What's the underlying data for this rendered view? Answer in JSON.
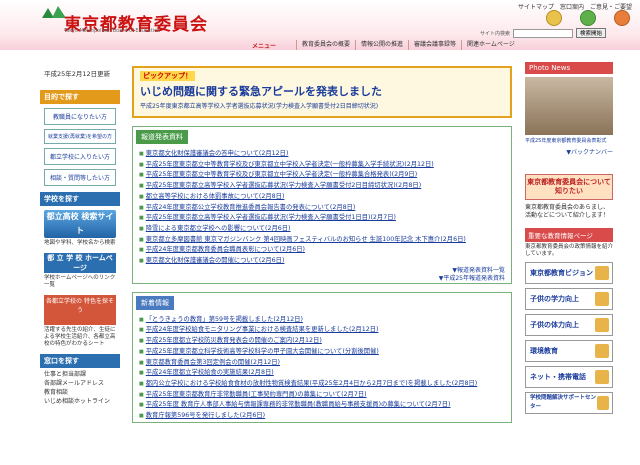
{
  "header": {
    "title": "東京都教育委員会",
    "subtitle": "Tokyo Metropolitan Board of Education",
    "top_links": [
      "サイトマップ",
      "窓口案内",
      "ご意見・ご要望"
    ],
    "search_label": "サイト内検索",
    "search_button": "検索開始"
  },
  "nav": {
    "menu_label": "メニュー",
    "items": [
      "教育委員会の概要",
      "情報公開の推進",
      "審議会議事録等",
      "関連ホームページ"
    ]
  },
  "date": "平成25年2月12日更新",
  "left": {
    "purpose_head": "目的で探す",
    "purpose_buttons": [
      "教職員になりたい方",
      "就業支援(再就業)を希望の方",
      "都立学校に入りたい方",
      "相談・質問等したい方"
    ],
    "school_head": "学校を探す",
    "banner1": "都立高校 検索サイト",
    "banner1_desc": "地図や学科、学校名から検索",
    "banner2": "都 立 学 校 ホームページ",
    "banner2_desc": "学校ホームページへのリンク一覧",
    "banner3": "各都立学校の 特色を探そう",
    "banner3_desc": "活躍する先生の紹介、生徒による学校生活紹介、各都立高校の特色がわかるシート",
    "mado_head": "窓口を探す",
    "mado_links": [
      "仕事と担当部課",
      "各部課メールアドレス",
      "教育相談",
      "いじめ相談ホットライン"
    ]
  },
  "pickup": {
    "label": "ピックアップ！",
    "main": "いじめ問題に関する緊急アピールを発表しました",
    "sub": "平成25年度東京都立高等学校入学者選抜応募状況(学力検査入学願書受付2日目締切状況)"
  },
  "press": {
    "head": "報道発表資料",
    "items": [
      "東京都文化財保護審議会の答申について(2月12日)",
      "平成25年度東京都立中等教育学校及び東京都立中学校入学者決定(一般枠募集入学手続状況)(2月12日)",
      "平成25年度東京都立中等教育学校及び東京都立中学校入学者決定(一般枠募集合格発表)(2月9日)",
      "平成25年度東京都立高等学校入学者選抜応募状況(学力検査入学願書受付2日目締切状況)(2月8日)",
      "都立高等学校における体罰事故について(2月8日)",
      "平成24年度東京都公立学校教育推進委員会報告書の発表について(2月8日)",
      "平成25年度東京都立高等学校入学者選抜応募状況(学力検査入学願書受付1日目)(2月7日)",
      "降雪による東京都立学校への影響について(2月6日)",
      "東京都立多摩図書館 東京マガジンバンク 第4回映画フェスティバルのお知らせ 生誕100年記念 木下惠介(2月6日)",
      "平成24年度東京都教育委員会職員表彰について(2月6日)",
      "東京都文化財保護審議会の開催について(2月6日)"
    ],
    "more1": "▼報道発表資料一覧",
    "more2": "▼平成25年報道発表資料"
  },
  "news": {
    "head": "新着情報",
    "items": [
      "「とうきょうの教育」第59号を掲載しました(2月12日)",
      "平成24年度学校給食モニタリング事業における検査結果を更新しました(2月12日)",
      "平成25年度都立学校防災教育発表会の開催のご案内(2月12日)",
      "平成25年度東京都立科学技術高等学校科学の甲子園大会開催について(分割後開催)",
      "東京都教育委員会第3回定例会の開催(2月12日)",
      "平成24年度都立学校給食の実施結果(2月8日)",
      "都内公立学校における学校給食食材の放射性物質検査結果(平成25年2月4日から2月7日まで)を掲載しました(2月8日)",
      "平成25年度東京都教育庁非常勤職員(工事契約専門員)の募集について(2月7日)",
      "平成25年度 教育庁人事部人事給与情報課専務的非常勤職員(教職員給与事務支援員)の募集について(2月7日)",
      "教育庁報第596号を発行しました(2月6日)"
    ]
  },
  "right": {
    "photo_head": "Photo News",
    "photo_caption": "平成25年度東京都教育委員会表彰式",
    "back_number": "▼バックナンバー",
    "iinkai": "東京都教育委員会について知りたい",
    "iinkai_text": "東京都教育委員会のあらまし、活動などについて紹介します！",
    "imp_head": "重要な教育情報ページ",
    "imp_text": "東京都教育委員会の政策情報を紹介しています。",
    "buttons": [
      "東京都教育ビジョン",
      "子供の学力向上",
      "子供の体力向上",
      "環境教育",
      "ネット・携帯電話",
      "学校問題解決サポートセンター"
    ]
  }
}
